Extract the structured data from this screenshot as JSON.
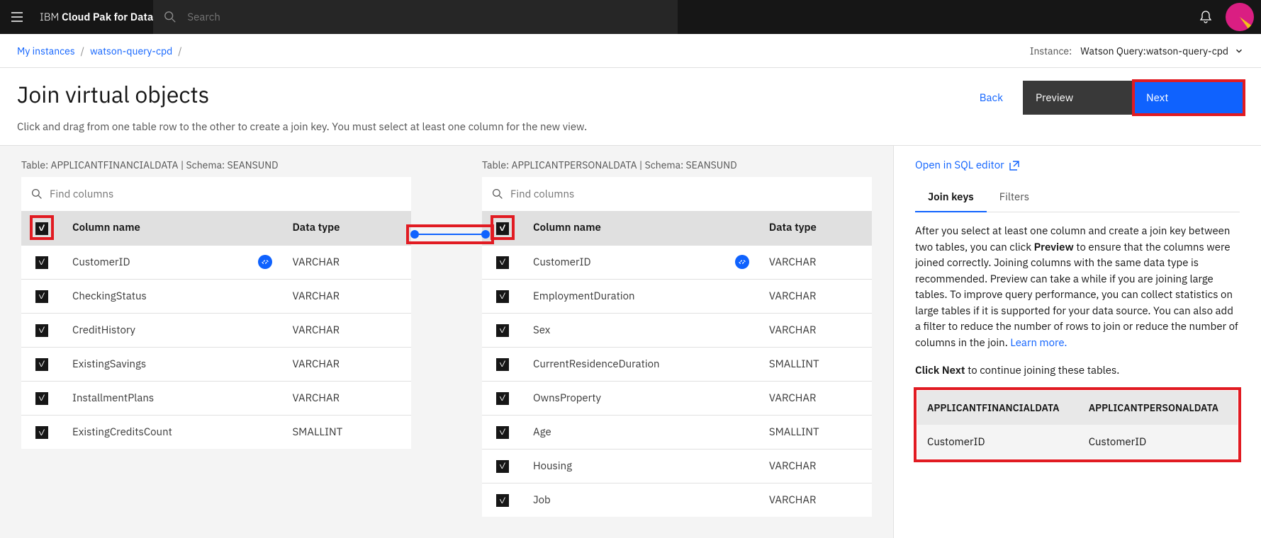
{
  "brand": {
    "light": "IBM ",
    "bold": "Cloud Pak for Data"
  },
  "search": {
    "placeholder": "Search"
  },
  "breadcrumb": {
    "a": "My instances",
    "b": "watson-query-cpd"
  },
  "instance": {
    "label": "Instance:",
    "value": "Watson Query:watson-query-cpd"
  },
  "page": {
    "title": "Join virtual objects",
    "subtitle": "Click and drag from one table row to the other to create a join key. You must select at least one column for the new view.",
    "back": "Back",
    "preview": "Preview",
    "next": "Next"
  },
  "table_labels": {
    "col_name": "Column name",
    "data_type": "Data type",
    "find": "Find columns",
    "tbl": "Table:",
    "schema": "Schema:"
  },
  "table1": {
    "name": "APPLICANTFINANCIALDATA",
    "schema": "SEANSUND",
    "rows": [
      {
        "name": "CustomerID",
        "type": "VARCHAR",
        "linked": true
      },
      {
        "name": "CheckingStatus",
        "type": "VARCHAR"
      },
      {
        "name": "CreditHistory",
        "type": "VARCHAR"
      },
      {
        "name": "ExistingSavings",
        "type": "VARCHAR"
      },
      {
        "name": "InstallmentPlans",
        "type": "VARCHAR"
      },
      {
        "name": "ExistingCreditsCount",
        "type": "SMALLINT"
      }
    ]
  },
  "table2": {
    "name": "APPLICANTPERSONALDATA",
    "schema": "SEANSUND",
    "rows": [
      {
        "name": "CustomerID",
        "type": "VARCHAR",
        "linked": true
      },
      {
        "name": "EmploymentDuration",
        "type": "VARCHAR"
      },
      {
        "name": "Sex",
        "type": "VARCHAR"
      },
      {
        "name": "CurrentResidenceDuration",
        "type": "SMALLINT"
      },
      {
        "name": "OwnsProperty",
        "type": "VARCHAR"
      },
      {
        "name": "Age",
        "type": "SMALLINT"
      },
      {
        "name": "Housing",
        "type": "VARCHAR"
      },
      {
        "name": "Job",
        "type": "VARCHAR"
      }
    ]
  },
  "right": {
    "sql_link": "Open in SQL editor",
    "tabs": {
      "keys": "Join keys",
      "filters": "Filters"
    },
    "help_pre": "After you select at least one column and create a join key between two tables, you can click ",
    "help_preview": "Preview",
    "help_post": " to ensure that the columns were joined correctly. Joining columns with the same data type is recommended. Preview can take a while if you are joining large tables. To improve query performance, you can collect statistics on large tables if it is supported for your data source. You can also add a filter to reduce the number of rows to join or reduce the number of columns in the join. ",
    "learn": "Learn more.",
    "cta_bold": "Click Next",
    "cta_rest": " to continue joining these tables.",
    "keys_table": {
      "h1": "APPLICANTFINANCIALDATA",
      "h2": "APPLICANTPERSONALDATA",
      "c1": "CustomerID",
      "c2": "CustomerID"
    }
  }
}
